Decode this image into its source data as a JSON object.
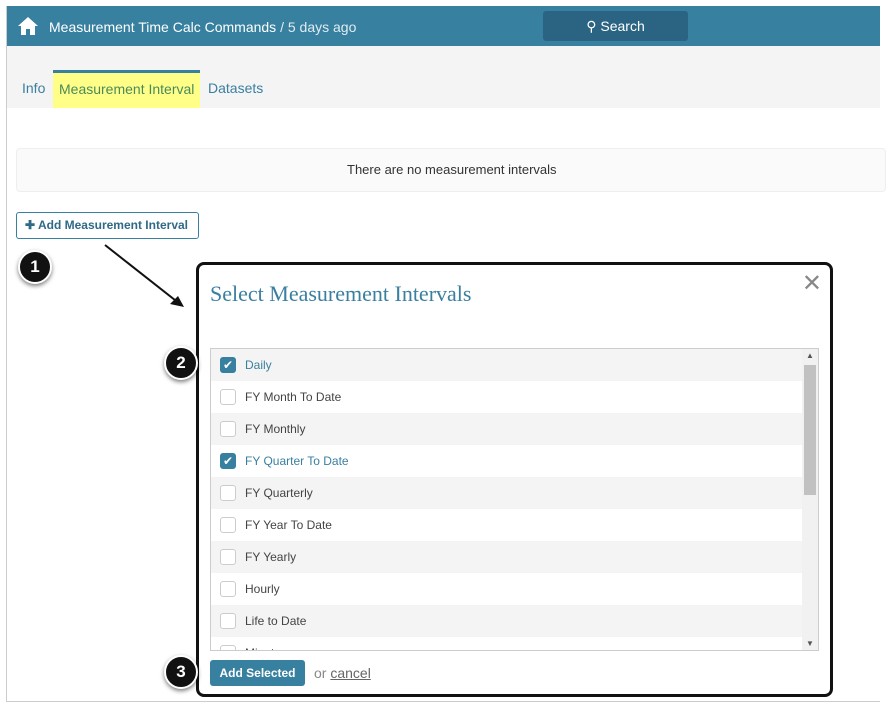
{
  "header": {
    "title": "Measurement Time Calc Commands",
    "subtitle": " / 5 days ago",
    "search_label": "Search"
  },
  "tabs": [
    {
      "label": "Info"
    },
    {
      "label": "Measurement Interval"
    },
    {
      "label": "Datasets"
    }
  ],
  "empty_message": "There are no measurement intervals",
  "add_button": "Add Measurement Interval",
  "badges": [
    "1",
    "2",
    "3"
  ],
  "modal": {
    "title": "Select Measurement Intervals",
    "close": "✕",
    "items": [
      {
        "label": "Daily",
        "checked": true
      },
      {
        "label": "FY Month To Date",
        "checked": false
      },
      {
        "label": "FY Monthly",
        "checked": false
      },
      {
        "label": "FY Quarter To Date",
        "checked": true
      },
      {
        "label": "FY Quarterly",
        "checked": false
      },
      {
        "label": "FY Year To Date",
        "checked": false
      },
      {
        "label": "FY Yearly",
        "checked": false
      },
      {
        "label": "Hourly",
        "checked": false
      },
      {
        "label": "Life to Date",
        "checked": false
      },
      {
        "label": "Minute",
        "checked": false
      }
    ],
    "add_selected": "Add Selected",
    "or": "or",
    "cancel": "cancel"
  }
}
